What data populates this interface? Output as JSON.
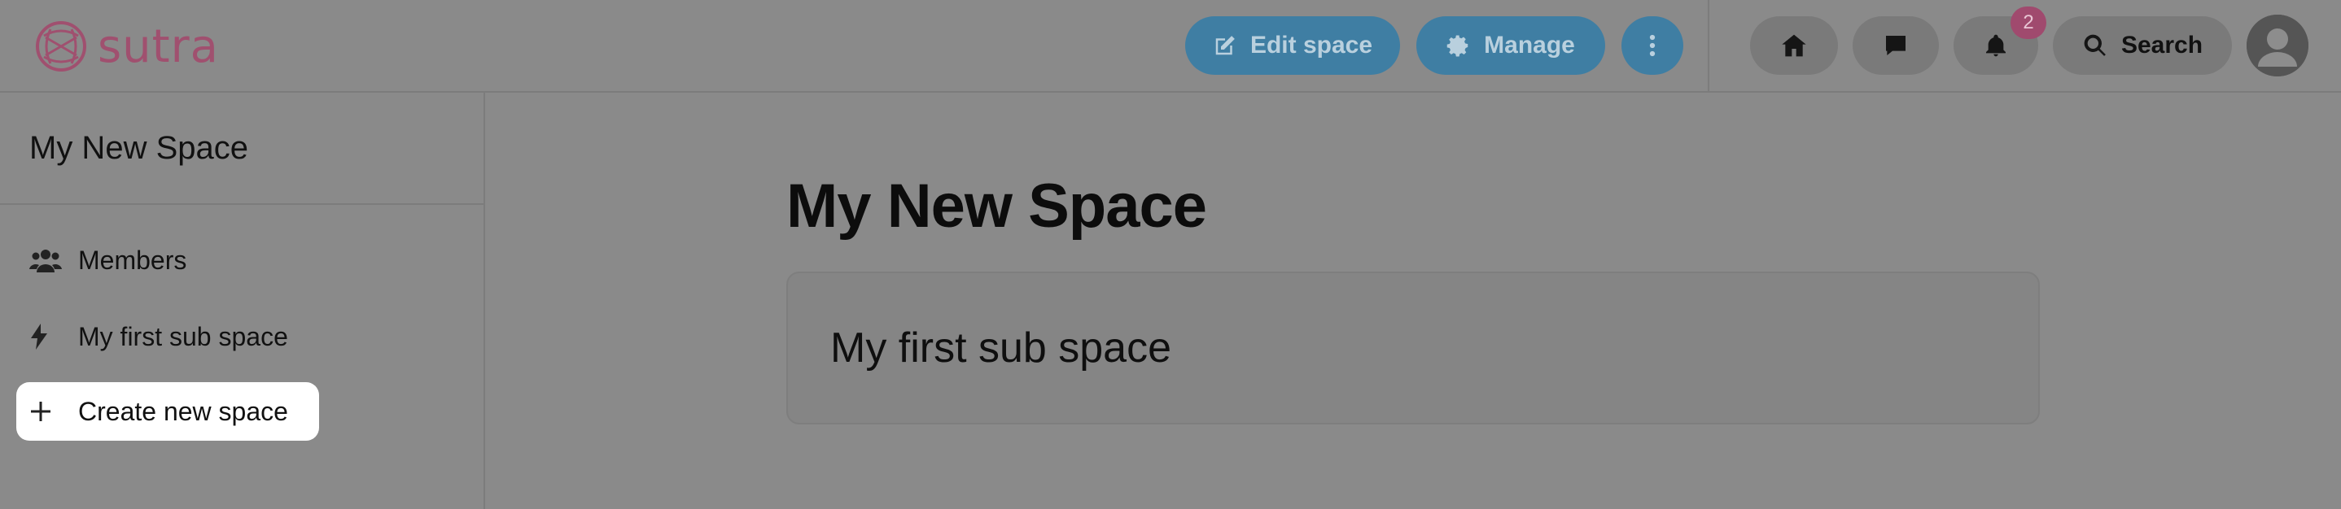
{
  "header": {
    "logo_text": "sutra",
    "edit_space_label": "Edit space",
    "manage_label": "Manage",
    "notification_count": "2",
    "search_label": "Search"
  },
  "sidebar": {
    "title": "My New Space",
    "items": [
      {
        "label": "Members",
        "icon": "users-icon"
      },
      {
        "label": "My first sub space",
        "icon": "bolt-icon"
      },
      {
        "label": "Create new space",
        "icon": "plus-icon"
      }
    ]
  },
  "main": {
    "title": "My New Space",
    "cards": [
      {
        "title": "My first sub space"
      }
    ]
  },
  "colors": {
    "overlay_bg": "#8a8a8a",
    "primary_button": "#3f7ea3",
    "brand": "#a0506f",
    "badge": "#a04a6e"
  }
}
